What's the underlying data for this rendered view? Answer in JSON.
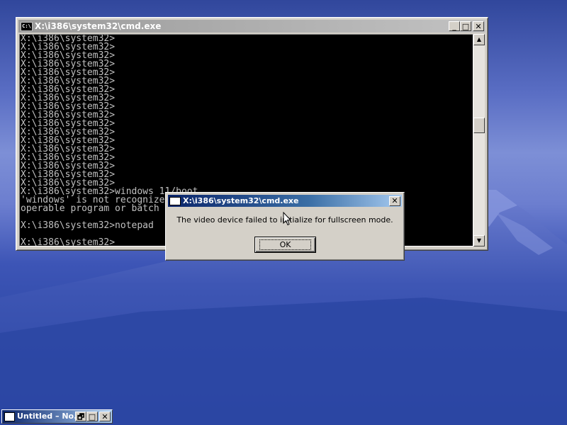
{
  "desktop": {
    "sky_color": "#3b51ad",
    "mountain_color": "#2b46a3"
  },
  "cmd_window": {
    "title": "X:\\i386\\system32\\cmd.exe",
    "icon": "cmd-app-icon",
    "icon_text": "C:\\",
    "buttons": {
      "minimize": "_",
      "maximize": "□",
      "close": "✕"
    },
    "console_lines": [
      "X:\\i386\\system32>",
      "X:\\i386\\system32>",
      "X:\\i386\\system32>",
      "X:\\i386\\system32>",
      "X:\\i386\\system32>",
      "X:\\i386\\system32>",
      "X:\\i386\\system32>",
      "X:\\i386\\system32>",
      "X:\\i386\\system32>",
      "X:\\i386\\system32>",
      "X:\\i386\\system32>",
      "X:\\i386\\system32>",
      "X:\\i386\\system32>",
      "X:\\i386\\system32>",
      "X:\\i386\\system32>",
      "X:\\i386\\system32>",
      "X:\\i386\\system32>",
      "X:\\i386\\system32>",
      "X:\\i386\\system32>windows 11/boot",
      "'windows' is not recognize",
      "operable program or batch",
      "",
      "X:\\i386\\system32>notepad",
      "",
      "X:\\i386\\system32>"
    ],
    "scrollbar": {
      "up": "▲",
      "down": "▼"
    }
  },
  "dialog": {
    "title": "X:\\i386\\system32\\cmd.exe",
    "close": "✕",
    "message": "The video device failed to initialize for fullscreen mode.",
    "ok_label": "OK"
  },
  "minimized_window": {
    "title": "Untitled – No...",
    "buttons": {
      "restore": "🗗",
      "maximize": "□",
      "close": "✕"
    }
  }
}
